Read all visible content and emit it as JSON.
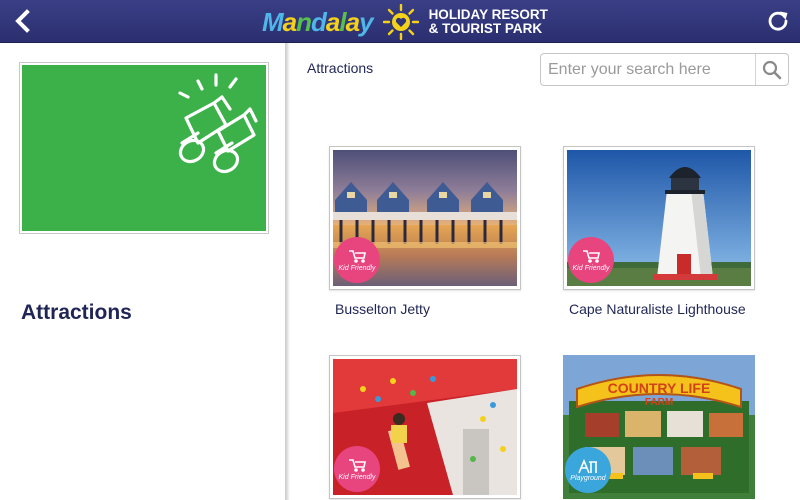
{
  "header": {
    "logo_word": "Mandalay",
    "logo_tagline_line1": "HOLIDAY RESORT",
    "logo_tagline_line2": "& TOURIST PARK"
  },
  "sidebar": {
    "category_title": "Attractions",
    "category_color": "#3cb14a"
  },
  "main": {
    "section_title": "Attractions",
    "search_placeholder": "Enter your search here"
  },
  "attractions": [
    {
      "name": "Busselton Jetty",
      "badge": "Kid Friendly",
      "badge_color": "#e8457f"
    },
    {
      "name": "Cape Naturaliste Lighthouse",
      "badge": "Kid Friendly",
      "badge_color": "#e8457f"
    },
    {
      "name": "",
      "badge": "Kid Friendly",
      "badge_color": "#e8457f"
    },
    {
      "name": "",
      "badge": "Playground",
      "badge_color": "#3aa6db",
      "sign_text_line1": "COUNTRY LIFE",
      "sign_text_line2": "FARM"
    }
  ],
  "colors": {
    "header_bg": "#2f3478",
    "title_text": "#1f2555"
  }
}
